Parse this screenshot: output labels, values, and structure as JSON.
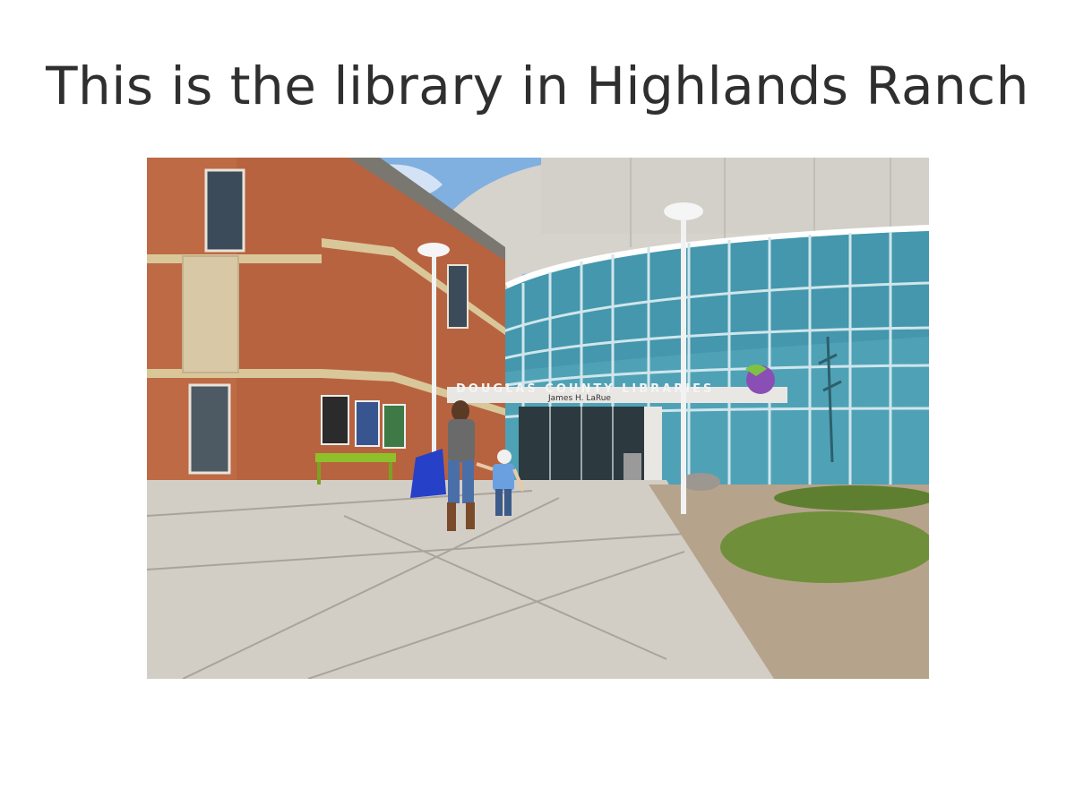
{
  "slide": {
    "title": "This is the library in Highlands Ranch"
  },
  "photo": {
    "sign_main": "DOUGLAS COUNTY LIBRARIES",
    "sign_sub": "James H. LaRue",
    "colors": {
      "brick": "#b8633f",
      "drum": "#d6d2cc",
      "glass": "#4fa2b6",
      "sky": "#7fb0e0",
      "pavement": "#d3cec5",
      "grass": "#6f8f3a",
      "bench": "#8fbf2a",
      "bag": "#2740c8"
    }
  }
}
